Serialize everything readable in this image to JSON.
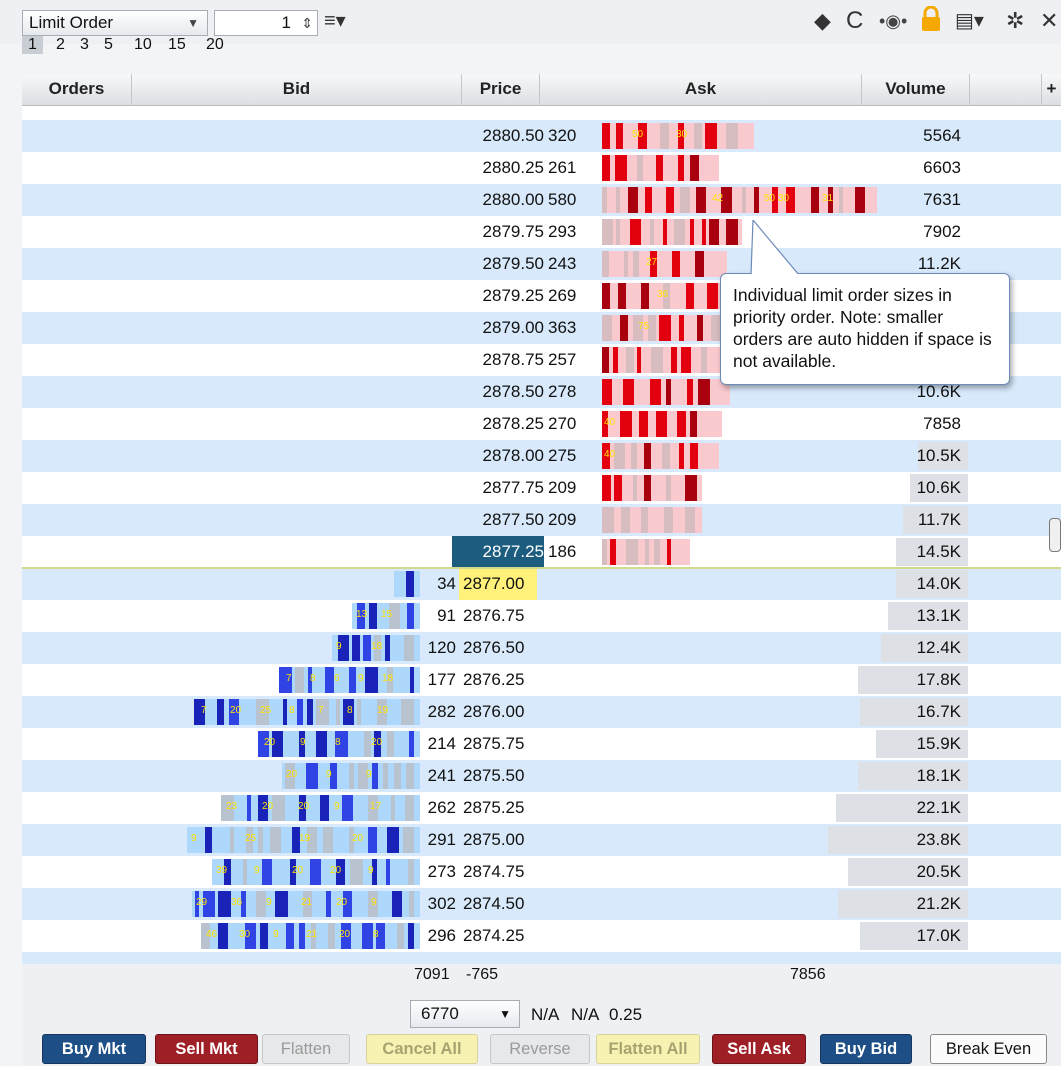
{
  "toolbar": {
    "order_type": "Limit Order",
    "quantity": "1",
    "icons": [
      "eraser-icon",
      "refresh-icon",
      "center-icon",
      "lock-icon",
      "layout-icon",
      "settings-icon",
      "close-icon"
    ],
    "colors": {
      "lock": "#f5a800"
    }
  },
  "quick_qty": [
    "1",
    "2",
    "3",
    "5",
    "10",
    "15",
    "20"
  ],
  "headers": {
    "orders": "Orders",
    "bid": "Bid",
    "price": "Price",
    "ask": "Ask",
    "volume": "Volume",
    "add": "+"
  },
  "ask_rows": [
    {
      "price": "2880.50",
      "size": "320",
      "volume": "5564",
      "labels": [
        "50",
        "30"
      ]
    },
    {
      "price": "2880.25",
      "size": "261",
      "volume": "6603",
      "labels": []
    },
    {
      "price": "2880.00",
      "size": "580",
      "volume": "7631",
      "labels": [
        "42",
        "50",
        "30",
        "31"
      ]
    },
    {
      "price": "2879.75",
      "size": "293",
      "volume": "7902",
      "labels": []
    },
    {
      "price": "2879.50",
      "size": "243",
      "volume": "11.2K",
      "labels": [
        "27"
      ]
    },
    {
      "price": "2879.25",
      "size": "269",
      "volume": "",
      "labels": [
        "36"
      ]
    },
    {
      "price": "2879.00",
      "size": "363",
      "volume": "",
      "labels": [
        "75"
      ]
    },
    {
      "price": "2878.75",
      "size": "257",
      "volume": "",
      "labels": []
    },
    {
      "price": "2878.50",
      "size": "278",
      "volume": "10.6K",
      "labels": []
    },
    {
      "price": "2878.25",
      "size": "270",
      "volume": "7858",
      "labels": [
        "40"
      ]
    },
    {
      "price": "2878.00",
      "size": "275",
      "volume": "10.5K",
      "labels": [
        "40"
      ]
    },
    {
      "price": "2877.75",
      "size": "209",
      "volume": "10.6K",
      "labels": []
    },
    {
      "price": "2877.50",
      "size": "209",
      "volume": "11.7K",
      "labels": []
    },
    {
      "price": "2877.25",
      "size": "186",
      "volume": "14.5K",
      "labels": []
    }
  ],
  "bid_rows": [
    {
      "price": "2877.00",
      "size": "34",
      "volume": "14.0K",
      "labels": []
    },
    {
      "price": "2876.75",
      "size": "91",
      "volume": "13.1K",
      "labels": [
        "13",
        "15"
      ]
    },
    {
      "price": "2876.50",
      "size": "120",
      "volume": "12.4K",
      "labels": [
        "9",
        "18"
      ]
    },
    {
      "price": "2876.25",
      "size": "177",
      "volume": "17.8K",
      "labels": [
        "7",
        "8",
        "6",
        "9",
        "18"
      ]
    },
    {
      "price": "2876.00",
      "size": "282",
      "volume": "16.7K",
      "labels": [
        "7",
        "20",
        "25",
        "8",
        "7",
        "8",
        "19"
      ]
    },
    {
      "price": "2875.75",
      "size": "214",
      "volume": "15.9K",
      "labels": [
        "20",
        "9",
        "8",
        "20"
      ]
    },
    {
      "price": "2875.50",
      "size": "241",
      "volume": "18.1K",
      "labels": [
        "20",
        "9",
        "9"
      ]
    },
    {
      "price": "2875.25",
      "size": "262",
      "volume": "22.1K",
      "labels": [
        "23",
        "20",
        "20",
        "9",
        "17"
      ]
    },
    {
      "price": "2875.00",
      "size": "291",
      "volume": "23.8K",
      "labels": [
        "9",
        "25",
        "19",
        "20"
      ]
    },
    {
      "price": "2874.75",
      "size": "273",
      "volume": "20.5K",
      "labels": [
        "39",
        "9",
        "20",
        "20",
        "9"
      ]
    },
    {
      "price": "2874.50",
      "size": "302",
      "volume": "21.2K",
      "labels": [
        "29",
        "36",
        "9",
        "21",
        "20",
        "9"
      ]
    },
    {
      "price": "2874.25",
      "size": "296",
      "volume": "17.0K",
      "labels": [
        "46",
        "30",
        "9",
        "21",
        "20",
        "8"
      ]
    }
  ],
  "totals": {
    "bid": "7091",
    "net": "-765",
    "ask": "7856"
  },
  "footer": {
    "qty_select": "6770",
    "na1": "N/A",
    "na2": "N/A",
    "tick": "0.25"
  },
  "tooltip": "Individual limit order sizes in priority order. Note: smaller orders are auto hidden if space is not available.",
  "buttons": [
    {
      "label": "Buy Mkt",
      "style": "blue"
    },
    {
      "label": "Sell Mkt",
      "style": "red"
    },
    {
      "label": "Flatten",
      "style": "dis"
    },
    {
      "label": "Cancel All",
      "style": "yel"
    },
    {
      "label": "Reverse",
      "style": "dis"
    },
    {
      "label": "Flatten All",
      "style": "yel"
    },
    {
      "label": "Sell Ask",
      "style": "red"
    },
    {
      "label": "Buy Bid",
      "style": "blue"
    },
    {
      "label": "Break Even",
      "style": "white"
    }
  ]
}
